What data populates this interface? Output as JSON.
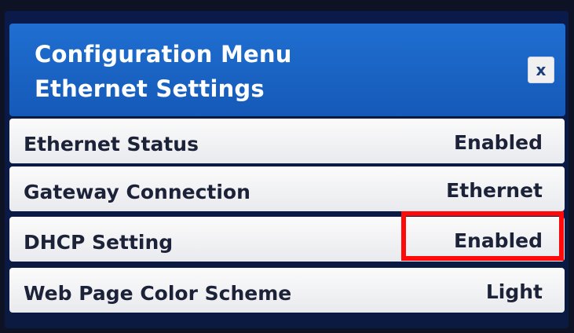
{
  "header": {
    "title_line1": "Configuration Menu",
    "title_line2": "Ethernet Settings",
    "close_label": "x"
  },
  "rows": [
    {
      "label": "Ethernet Status",
      "value": "Enabled"
    },
    {
      "label": "Gateway Connection",
      "value": "Ethernet"
    },
    {
      "label": "DHCP Setting",
      "value": "Enabled"
    },
    {
      "label": "Web Page Color Scheme",
      "value": "Light"
    }
  ],
  "colors": {
    "header_blue": "#1f6fd1",
    "highlight_red": "#ff0a0a",
    "row_bg": "#f5f5f7"
  }
}
